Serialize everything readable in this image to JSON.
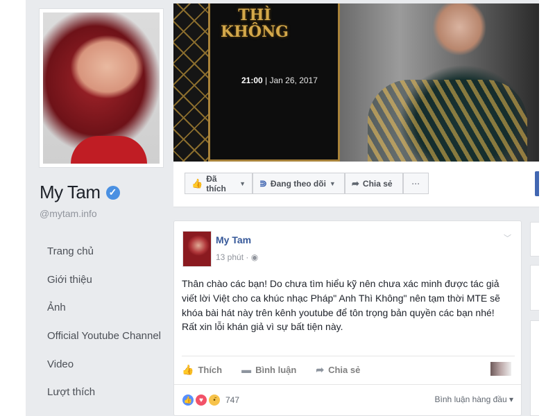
{
  "profile": {
    "name": "My Tam",
    "handle": "@mytam.info"
  },
  "nav": [
    {
      "label": "Trang chủ"
    },
    {
      "label": "Giới thiệu"
    },
    {
      "label": "Ảnh"
    },
    {
      "label": "Official Youtube Channel"
    },
    {
      "label": "Video"
    },
    {
      "label": "Lượt thích"
    }
  ],
  "cover": {
    "logo_line1": "THÌ",
    "logo_line2": "KHÔNG",
    "time": "21:00",
    "date": "| Jan 26, 2017"
  },
  "actions": {
    "liked": "Đã thích",
    "following": "Đang theo dõi",
    "share": "Chia sẻ",
    "more": "···"
  },
  "post": {
    "author": "My Tam",
    "time": "13 phút ·",
    "text": "Thân chào các bạn! Do chưa tìm hiểu kỹ nên chưa xác minh được tác giả\nviết lời Việt cho ca khúc nhạc Pháp\" Anh Thì Không\" nên tạm thời MTE sẽ\nkhóa bài hát này trên kênh youtube để tôn trọng bản quyền các bạn nhé!\nRất xin lỗi khán giả vì sự bất tiện này.",
    "like_label": "Thích",
    "comment_label": "Bình luận",
    "share_label": "Chia sẻ",
    "reaction_count": "747",
    "top_comments": "Bình luận hàng đầu ▾"
  },
  "colors": {
    "link_blue": "#365899",
    "fb_blue": "#4267b2",
    "page_bg": "#e9ebee",
    "verified": "#4a90e2"
  }
}
